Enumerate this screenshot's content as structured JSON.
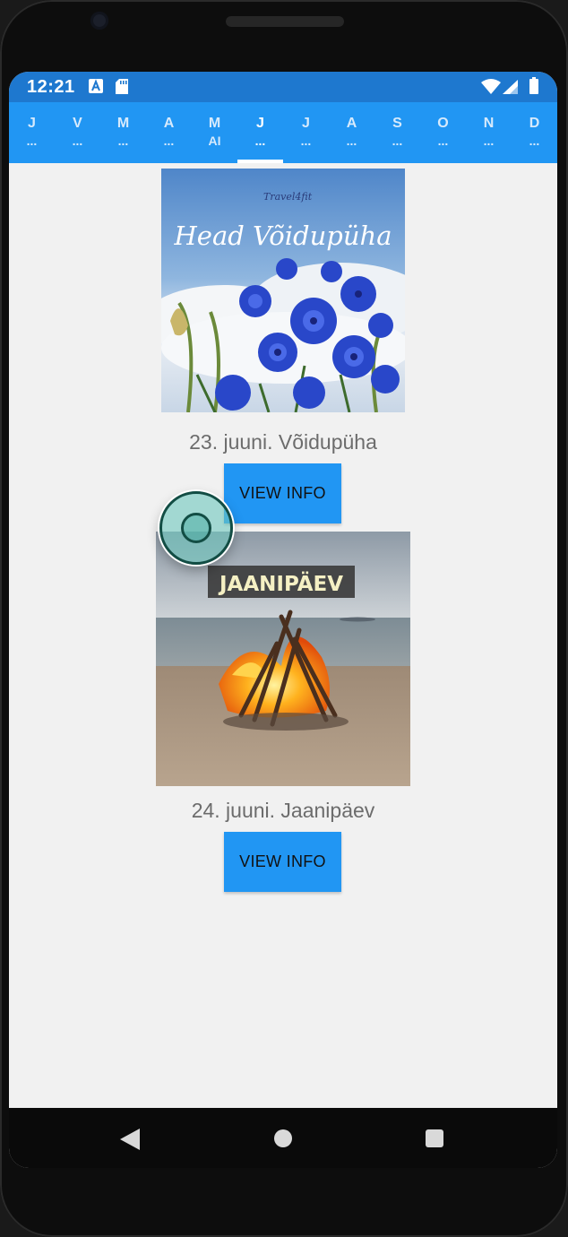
{
  "statusbar": {
    "time": "12:21",
    "icons": [
      "a-box-icon",
      "sd-card-icon",
      "wifi-icon",
      "signal-icon",
      "battery-icon"
    ]
  },
  "tabs": [
    {
      "line1": "J",
      "line2": "..."
    },
    {
      "line1": "V",
      "line2": "..."
    },
    {
      "line1": "M",
      "line2": "..."
    },
    {
      "line1": "A",
      "line2": "..."
    },
    {
      "line1": "M",
      "line2": "AI"
    },
    {
      "line1": "J",
      "line2": "...",
      "active": true
    },
    {
      "line1": "J",
      "line2": "..."
    },
    {
      "line1": "A",
      "line2": "..."
    },
    {
      "line1": "S",
      "line2": "..."
    },
    {
      "line1": "O",
      "line2": "..."
    },
    {
      "line1": "N",
      "line2": "..."
    },
    {
      "line1": "D",
      "line2": "..."
    }
  ],
  "events": [
    {
      "image_logo_text": "Travel4fit",
      "image_title": "Head Võidupüha",
      "caption": "23. juuni. Võidupüha",
      "button_label": "VIEW INFO"
    },
    {
      "image_title": "JAANIPÄEV",
      "caption": "24. juuni. Jaanipäev",
      "button_label": "VIEW INFO"
    }
  ],
  "colors": {
    "statusbar": "#1e78cf",
    "tabbar": "#2196f3",
    "button": "#2196f3",
    "background": "#f1f1f1",
    "caption": "#6c6c6c"
  },
  "navbar": {
    "icons": [
      "back-icon",
      "home-icon",
      "recents-icon"
    ]
  }
}
